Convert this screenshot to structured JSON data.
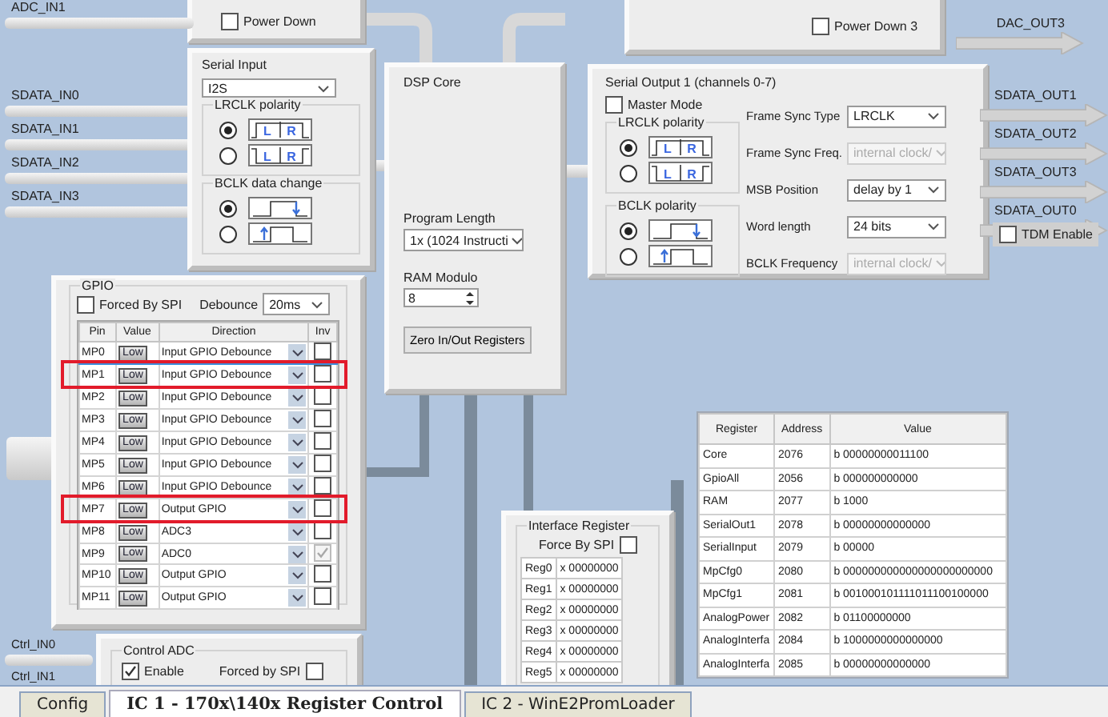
{
  "adc_panel": {
    "input_label": "ADC_IN1",
    "power_down": {
      "label": "Power Down",
      "checked": false
    }
  },
  "dac_panel": {
    "output_label": "DAC_OUT3",
    "power_down": {
      "label": "Power Down 3",
      "checked": false
    }
  },
  "inputs": [
    "SDATA_IN0",
    "SDATA_IN1",
    "SDATA_IN2",
    "SDATA_IN3"
  ],
  "serial_input": {
    "title": "Serial Input",
    "format": "I2S",
    "lrclk_polarity": {
      "title": "LRCLK polarity",
      "options": [
        {
          "kind": "normal",
          "selected": true,
          "letters": [
            "L",
            "R"
          ]
        },
        {
          "kind": "inverted",
          "selected": false,
          "letters": [
            "L",
            "R"
          ]
        }
      ]
    },
    "bclk_data_change": {
      "title": "BCLK data change",
      "options": [
        {
          "kind": "falling",
          "selected": true
        },
        {
          "kind": "rising",
          "selected": false
        }
      ]
    }
  },
  "dsp_core": {
    "title": "DSP Core",
    "program_length": {
      "label": "Program Length",
      "value": "1x (1024 Instructi"
    },
    "ram_modulo": {
      "label": "RAM Modulo",
      "value": "8"
    },
    "zero_button": "Zero In/Out Registers"
  },
  "serial_output": {
    "title": "Serial Output 1 (channels 0-7)",
    "master_mode": {
      "label": "Master Mode",
      "checked": false
    },
    "lrclk_polarity": {
      "title": "LRCLK polarity",
      "options": [
        {
          "kind": "normal",
          "selected": true,
          "letters": [
            "L",
            "R"
          ]
        },
        {
          "kind": "inverted",
          "selected": false,
          "letters": [
            "L",
            "R"
          ]
        }
      ]
    },
    "bclk_polarity": {
      "title": "BCLK polarity",
      "options": [
        {
          "kind": "falling",
          "selected": true
        },
        {
          "kind": "rising",
          "selected": false
        }
      ]
    },
    "settings": [
      {
        "label": "Frame Sync Type",
        "value": "LRCLK",
        "disabled": false
      },
      {
        "label": "Frame Sync Freq.",
        "value": "internal clock/",
        "disabled": true
      },
      {
        "label": "MSB Position",
        "value": "delay by 1",
        "disabled": false
      },
      {
        "label": "Word length",
        "value": "24 bits",
        "disabled": false
      },
      {
        "label": "BCLK Frequency",
        "value": "internal clock/",
        "disabled": true
      }
    ],
    "tdm_enable": {
      "label": "TDM Enable",
      "checked": false
    }
  },
  "outputs": [
    "SDATA_OUT1",
    "SDATA_OUT2",
    "SDATA_OUT3",
    "SDATA_OUT0"
  ],
  "gpio": {
    "title": "GPIO",
    "forced_by_spi": {
      "label": "Forced By SPI",
      "checked": false
    },
    "debounce": {
      "label": "Debounce",
      "value": "20ms"
    },
    "columns": [
      "Pin",
      "Value",
      "Direction",
      "Inv"
    ],
    "rows": [
      {
        "pin": "MP0",
        "value": "Low",
        "direction": "Input  GPIO Debounce",
        "inv": false,
        "inv_disabled": false,
        "selected": true,
        "marked": false
      },
      {
        "pin": "MP1",
        "value": "Low",
        "direction": "Input  GPIO Debounce",
        "inv": false,
        "inv_disabled": false,
        "selected": false,
        "marked": true
      },
      {
        "pin": "MP2",
        "value": "Low",
        "direction": "Input  GPIO Debounce",
        "inv": false,
        "inv_disabled": false,
        "selected": false,
        "marked": false
      },
      {
        "pin": "MP3",
        "value": "Low",
        "direction": "Input  GPIO Debounce",
        "inv": false,
        "inv_disabled": false,
        "selected": false,
        "marked": false
      },
      {
        "pin": "MP4",
        "value": "Low",
        "direction": "Input  GPIO Debounce",
        "inv": false,
        "inv_disabled": false,
        "selected": false,
        "marked": false
      },
      {
        "pin": "MP5",
        "value": "Low",
        "direction": "Input  GPIO Debounce",
        "inv": false,
        "inv_disabled": false,
        "selected": false,
        "marked": false
      },
      {
        "pin": "MP6",
        "value": "Low",
        "direction": "Input  GPIO Debounce",
        "inv": false,
        "inv_disabled": false,
        "selected": false,
        "marked": false
      },
      {
        "pin": "MP7",
        "value": "Low",
        "direction": "Output GPIO",
        "inv": false,
        "inv_disabled": false,
        "selected": false,
        "marked": true
      },
      {
        "pin": "MP8",
        "value": "Low",
        "direction": "ADC3",
        "inv": false,
        "inv_disabled": false,
        "selected": false,
        "marked": false
      },
      {
        "pin": "MP9",
        "value": "Low",
        "direction": "ADC0",
        "inv": true,
        "inv_disabled": true,
        "selected": false,
        "marked": false
      },
      {
        "pin": "MP10",
        "value": "Low",
        "direction": "Output GPIO",
        "inv": false,
        "inv_disabled": false,
        "selected": false,
        "marked": false
      },
      {
        "pin": "MP11",
        "value": "Low",
        "direction": "Output GPIO",
        "inv": false,
        "inv_disabled": false,
        "selected": false,
        "marked": false
      }
    ]
  },
  "ctrl_inputs": [
    "Ctrl_IN0",
    "Ctrl_IN1"
  ],
  "control_adc": {
    "title": "Control ADC",
    "enable": {
      "label": "Enable",
      "checked": true
    },
    "forced_by_spi": {
      "label": "Forced by SPI",
      "checked": false
    }
  },
  "interface_register": {
    "title": "Interface Register",
    "force_by_spi": {
      "label": "Force By SPI",
      "checked": false
    },
    "rows": [
      {
        "name": "Reg0",
        "value": "x 00000000"
      },
      {
        "name": "Reg1",
        "value": "x 00000000"
      },
      {
        "name": "Reg2",
        "value": "x 00000000"
      },
      {
        "name": "Reg3",
        "value": "x 00000000"
      },
      {
        "name": "Reg4",
        "value": "x 00000000"
      },
      {
        "name": "Reg5",
        "value": "x 00000000"
      }
    ]
  },
  "register_table": {
    "columns": [
      "Register",
      "Address",
      "Value"
    ],
    "rows": [
      [
        "Core",
        "2076",
        "b 00000000011100"
      ],
      [
        "GpioAll",
        "2056",
        "b 000000000000"
      ],
      [
        "RAM",
        "2077",
        "b 1000"
      ],
      [
        "SerialOut1",
        "2078",
        "b 00000000000000"
      ],
      [
        "SerialInput",
        "2079",
        "b 00000"
      ],
      [
        "MpCfg0",
        "2080",
        "b 000000000000000000000000"
      ],
      [
        "MpCfg1",
        "2081",
        "b 001000101111011100100000"
      ],
      [
        "AnalogPower",
        "2082",
        "b 01100000000"
      ],
      [
        "AnalogInterfa",
        "2084",
        "b 1000000000000000"
      ],
      [
        "AnalogInterfa",
        "2085",
        "b 00000000000000"
      ]
    ]
  },
  "tabs": [
    {
      "label": "Config",
      "selected": false
    },
    {
      "label": "IC 1 - 170x\\140x Register Control",
      "selected": true
    },
    {
      "label": "IC 2 - WinE2PromLoader",
      "selected": false
    }
  ]
}
